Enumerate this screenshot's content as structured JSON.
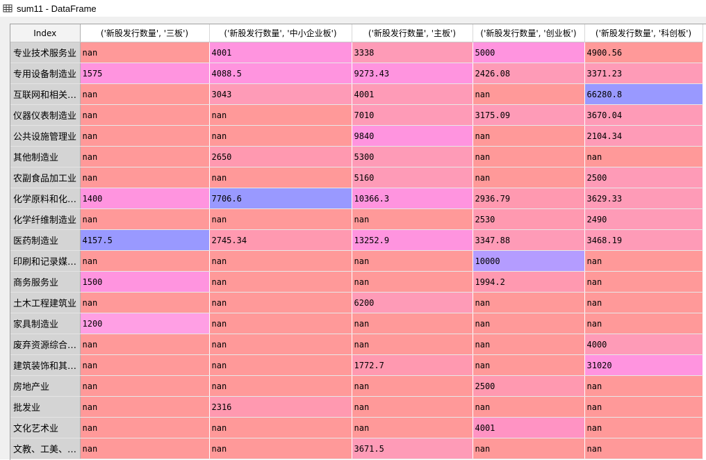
{
  "window": {
    "title": "sum11 - DataFrame",
    "icon": "table-grid-icon"
  },
  "table": {
    "index_header": "Index",
    "columns": [
      "('新股发行数量', '三板')",
      "('新股发行数量', '中小企业板')",
      "('新股发行数量', '主板')",
      "('新股发行数量', '创业板')",
      "('新股发行数量', '科创板')"
    ],
    "rows": [
      {
        "index": "专业技术服务业",
        "cells": [
          "nan",
          "4001",
          "3338",
          "5000",
          "4900.56"
        ]
      },
      {
        "index": "专用设备制造业",
        "cells": [
          "1575",
          "4088.5",
          "9273.43",
          "2426.08",
          "3371.23"
        ]
      },
      {
        "index": "互联网和相关…",
        "cells": [
          "nan",
          "3043",
          "4001",
          "nan",
          "66280.8"
        ]
      },
      {
        "index": "仪器仪表制造业",
        "cells": [
          "nan",
          "nan",
          "7010",
          "3175.09",
          "3670.04"
        ]
      },
      {
        "index": "公共设施管理业",
        "cells": [
          "nan",
          "nan",
          "9840",
          "nan",
          "2104.34"
        ]
      },
      {
        "index": "其他制造业",
        "cells": [
          "nan",
          "2650",
          "5300",
          "nan",
          "nan"
        ]
      },
      {
        "index": "农副食品加工业",
        "cells": [
          "nan",
          "nan",
          "5160",
          "nan",
          "2500"
        ]
      },
      {
        "index": "化学原料和化…",
        "cells": [
          "1400",
          "7706.6",
          "10366.3",
          "2936.79",
          "3629.33"
        ]
      },
      {
        "index": "化学纤维制造业",
        "cells": [
          "nan",
          "nan",
          "nan",
          "2530",
          "2490"
        ]
      },
      {
        "index": "医药制造业",
        "cells": [
          "4157.5",
          "2745.34",
          "13252.9",
          "3347.88",
          "3468.19"
        ]
      },
      {
        "index": "印刷和记录媒…",
        "cells": [
          "nan",
          "nan",
          "nan",
          "10000",
          "nan"
        ]
      },
      {
        "index": "商务服务业",
        "cells": [
          "1500",
          "nan",
          "nan",
          "1994.2",
          "nan"
        ]
      },
      {
        "index": "土木工程建筑业",
        "cells": [
          "nan",
          "nan",
          "6200",
          "nan",
          "nan"
        ]
      },
      {
        "index": "家具制造业",
        "cells": [
          "1200",
          "nan",
          "nan",
          "nan",
          "nan"
        ]
      },
      {
        "index": "废弃资源综合…",
        "cells": [
          "nan",
          "nan",
          "nan",
          "nan",
          "4000"
        ]
      },
      {
        "index": "建筑装饰和其…",
        "cells": [
          "nan",
          "nan",
          "1772.7",
          "nan",
          "31020"
        ]
      },
      {
        "index": "房地产业",
        "cells": [
          "nan",
          "nan",
          "nan",
          "2500",
          "nan"
        ]
      },
      {
        "index": "批发业",
        "cells": [
          "nan",
          "2316",
          "nan",
          "nan",
          "nan"
        ]
      },
      {
        "index": "文化艺术业",
        "cells": [
          "nan",
          "nan",
          "nan",
          "4001",
          "nan"
        ]
      },
      {
        "index": "文教、工美、…",
        "cells": [
          "nan",
          "nan",
          "3671.5",
          "nan",
          "nan"
        ]
      }
    ],
    "cell_classes": [
      [
        "c-nan",
        "c-3",
        "c-2",
        "c-3",
        "c-nan"
      ],
      [
        "c-3",
        "c-3",
        "c-3",
        "c-2",
        "c-2"
      ],
      [
        "c-nan",
        "c-2",
        "c-2",
        "c-nan",
        "c-5"
      ],
      [
        "c-nan",
        "c-nan",
        "c-2",
        "c-2",
        "c-2"
      ],
      [
        "c-nan",
        "c-nan",
        "c-3",
        "c-nan",
        "c-2"
      ],
      [
        "c-nan",
        "c-7",
        "c-2",
        "c-nan",
        "c-nan"
      ],
      [
        "c-nan",
        "c-nan",
        "c-2",
        "c-nan",
        "c-2"
      ],
      [
        "c-3",
        "c-5",
        "c-3",
        "c-7",
        "c-2"
      ],
      [
        "c-nan",
        "c-nan",
        "c-nan",
        "c-7",
        "c-2"
      ],
      [
        "c-5",
        "c-7",
        "c-3",
        "c-2",
        "c-2"
      ],
      [
        "c-nan",
        "c-nan",
        "c-nan",
        "c-9",
        "c-nan"
      ],
      [
        "c-3",
        "c-nan",
        "c-nan",
        "c-7",
        "c-nan"
      ],
      [
        "c-nan",
        "c-nan",
        "c-2",
        "c-nan",
        "c-nan"
      ],
      [
        "c-4",
        "c-nan",
        "c-nan",
        "c-nan",
        "c-nan"
      ],
      [
        "c-nan",
        "c-nan",
        "c-nan",
        "c-nan",
        "c-2"
      ],
      [
        "c-nan",
        "c-nan",
        "c-7",
        "c-nan",
        "c-3"
      ],
      [
        "c-nan",
        "c-nan",
        "c-nan",
        "c-7",
        "c-nan"
      ],
      [
        "c-nan",
        "c-7",
        "c-nan",
        "c-nan",
        "c-nan"
      ],
      [
        "c-nan",
        "c-nan",
        "c-nan",
        "c-1",
        "c-nan"
      ],
      [
        "c-nan",
        "c-nan",
        "c-2",
        "c-nan",
        "c-nan"
      ]
    ]
  }
}
